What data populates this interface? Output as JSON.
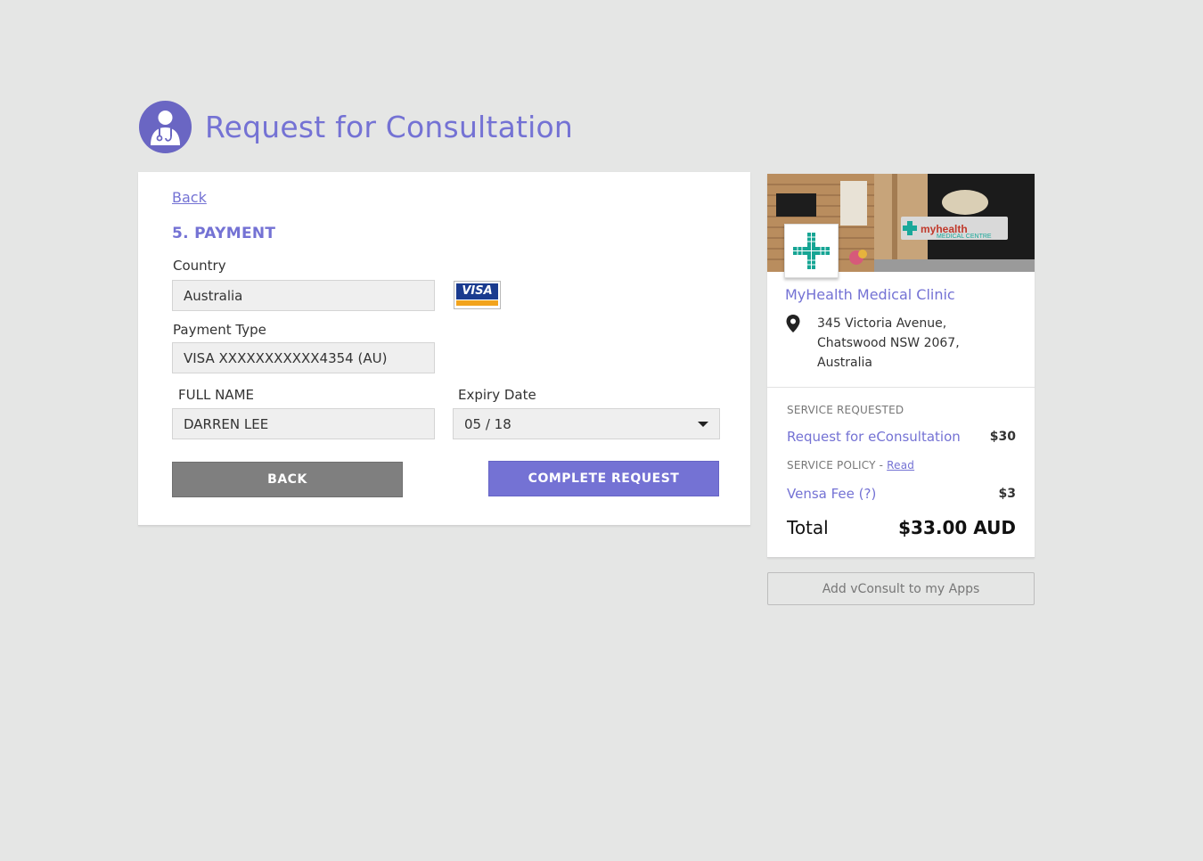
{
  "header": {
    "title": "Request for Consultation",
    "icon": "doctor-icon",
    "accent": "#7472d4"
  },
  "form": {
    "back_link": "Back",
    "section_title": "5. PAYMENT",
    "country_label": "Country",
    "country_value": "Australia",
    "card_brand": "VISA",
    "payment_type_label": "Payment Type",
    "payment_type_value": "VISA XXXXXXXXXXX4354 (AU)",
    "full_name_label": "FULL NAME",
    "full_name_value": "DARREN LEE",
    "expiry_label": "Expiry Date",
    "expiry_value": "05 / 18",
    "back_button": "BACK",
    "complete_button": "COMPLETE REQUEST"
  },
  "clinic": {
    "logo_text": "myhealth",
    "logo_subtext": "MEDICAL CENTRE",
    "name": "MyHealth Medical Clinic",
    "address_line1": "345 Victoria Avenue,",
    "address_line2": "Chatswood NSW 2067,",
    "address_line3": "Australia"
  },
  "summary": {
    "service_requested_label": "SERVICE REQUESTED",
    "service_name": "Request for eConsultation",
    "service_price": "$30",
    "service_policy_label": "SERVICE POLICY -",
    "service_policy_link": "Read",
    "fee_name": "Vensa Fee (?)",
    "fee_price": "$3",
    "total_label": "Total",
    "total_value": "$33.00 AUD"
  },
  "add_app_button": "Add vConsult to my Apps"
}
